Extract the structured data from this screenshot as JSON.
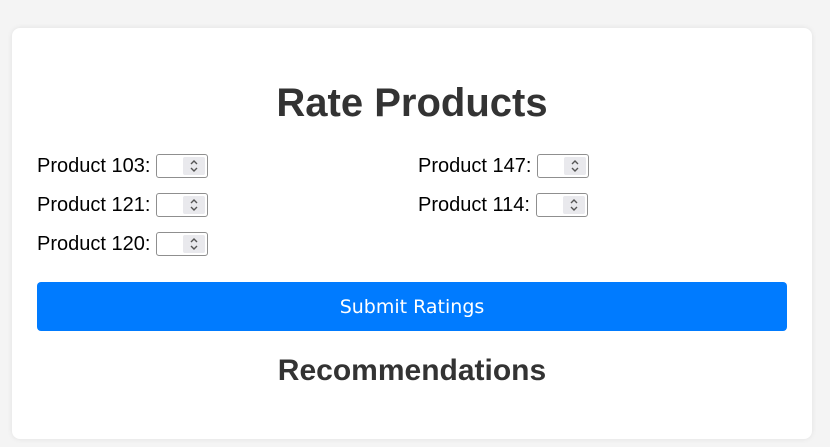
{
  "header": {
    "title": "Rate Products"
  },
  "ratings": [
    {
      "label": "Product 103:",
      "value": ""
    },
    {
      "label": "Product 147:",
      "value": ""
    },
    {
      "label": "Product 121:",
      "value": ""
    },
    {
      "label": "Product 114:",
      "value": ""
    },
    {
      "label": "Product 120:",
      "value": ""
    }
  ],
  "actions": {
    "submit_label": "Submit Ratings"
  },
  "recommendations": {
    "title": "Recommendations"
  },
  "colors": {
    "accent": "#007bff",
    "page_bg": "#f4f4f4",
    "card_bg": "#ffffff",
    "heading": "#333333"
  },
  "icons": {
    "stepper": "chevron-up-down-icon"
  }
}
